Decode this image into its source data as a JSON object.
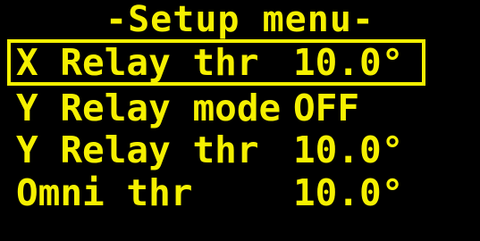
{
  "colors": {
    "background": "#000000",
    "text": "#f5f000",
    "selection_border": "#f5f000"
  },
  "menu": {
    "title": "-Setup menu-",
    "items": [
      {
        "label": "X Relay thr",
        "value": "10.0°",
        "selected": true
      },
      {
        "label": "Y Relay mode",
        "value": "OFF",
        "selected": false
      },
      {
        "label": "Y Relay thr",
        "value": "10.0°",
        "selected": false
      },
      {
        "label": "Omni thr",
        "value": "10.0°",
        "selected": false
      }
    ]
  }
}
